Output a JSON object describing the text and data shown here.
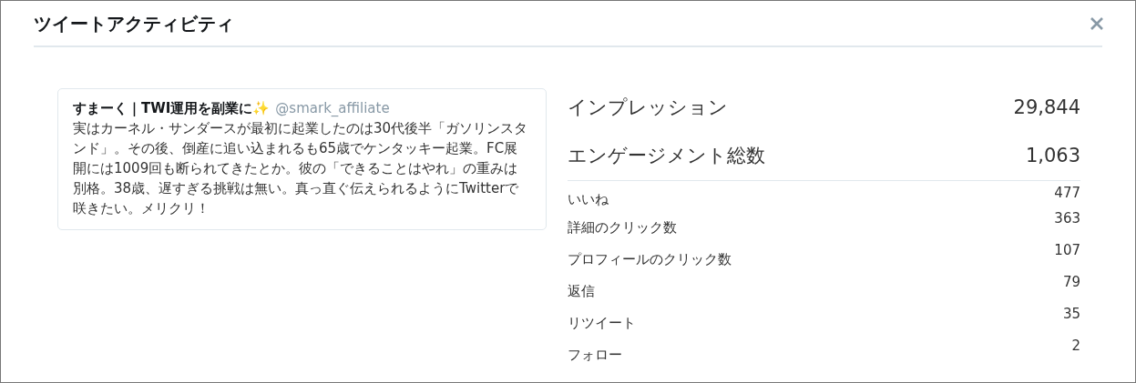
{
  "dialog": {
    "title": "ツイートアクティビティ"
  },
  "tweet": {
    "author": "すまーく｜TWI運用を副業に✨",
    "handle": "@smark_affiliate",
    "text": "実はカーネル・サンダースが最初に起業したのは30代後半「ガソリンスタンド」。その後、倒産に追い込まれるも65歳でケンタッキー起業。FC展開には1009回も断られてきたとか。彼の「できることはやれ」の重みは別格。38歳、遅すぎる挑戦は無い。真っ直ぐ伝えられるようにTwitterで咲きたい。メリクリ！"
  },
  "summary": [
    {
      "label": "インプレッション",
      "value": "29,844"
    },
    {
      "label": "エンゲージメント総数",
      "value": "1,063"
    }
  ],
  "details": [
    {
      "label": "いいね",
      "value": "477"
    },
    {
      "label": "詳細のクリック数",
      "value": "363"
    },
    {
      "label": "プロフィールのクリック数",
      "value": "107"
    },
    {
      "label": "返信",
      "value": "79"
    },
    {
      "label": "リツイート",
      "value": "35"
    },
    {
      "label": "フォロー",
      "value": "2"
    }
  ]
}
